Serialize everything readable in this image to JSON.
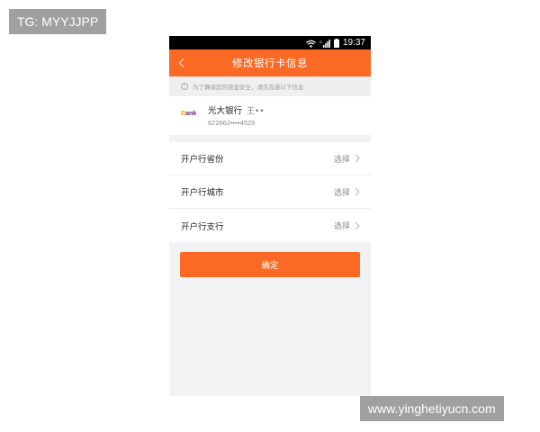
{
  "watermarks": {
    "top_left": "TG: MYYJJPP",
    "bottom_right": "www.yinghetiyucn.com"
  },
  "status_bar": {
    "time": "19:37",
    "icons": [
      "wifi-icon",
      "signal-icon",
      "battery-icon"
    ]
  },
  "nav": {
    "back_icon": "chevron-left-icon",
    "title": "修改银行卡信息"
  },
  "notice": {
    "icon": "info-icon",
    "text": "为了确保您的资金安全，请先完善以下信息"
  },
  "card": {
    "logo_text": "Bank",
    "bank_name": "光大银行",
    "holder": "王••",
    "card_number": "622662••••4529"
  },
  "fields": [
    {
      "label": "开户行省份",
      "action": "选择"
    },
    {
      "label": "开户行城市",
      "action": "选择"
    },
    {
      "label": "开户行支行",
      "action": "选择"
    }
  ],
  "confirm_label": "确定",
  "colors": {
    "accent": "#fb6a24",
    "page_bg": "#f2f2f4",
    "status_bar": "#000000"
  }
}
